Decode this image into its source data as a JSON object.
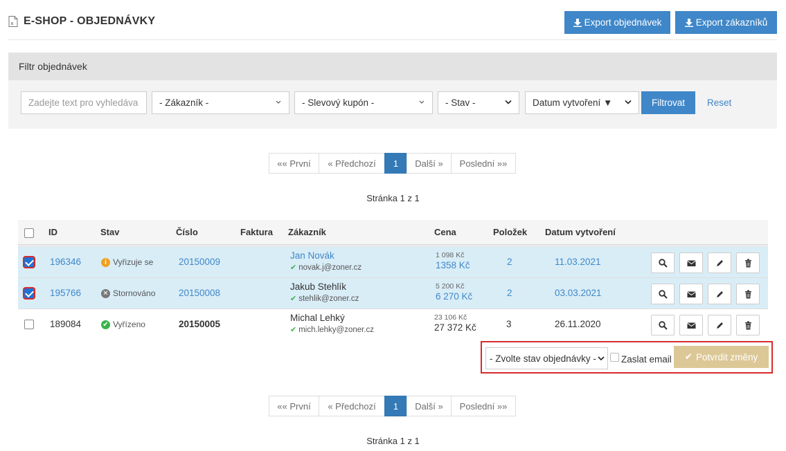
{
  "header": {
    "title": "E-SHOP - OBJEDNÁVKY",
    "export_orders": "Export objednávek",
    "export_customers": "Export zákazníků"
  },
  "filter": {
    "heading": "Filtr objednávek",
    "search_placeholder": "Zadejte text pro vyhledáva",
    "customer": "- Zákazník -",
    "coupon": "- Slevový kupón -",
    "state": "- Stav -",
    "sort": "Datum vytvoření ▼",
    "filter_button": "Filtrovat",
    "reset": "Reset"
  },
  "pagination": {
    "first": "«« První",
    "prev": "« Předchozí",
    "current": "1",
    "next": "Další »",
    "last": "Poslední »»",
    "info": "Stránka 1 z 1"
  },
  "table": {
    "columns": [
      "ID",
      "Stav",
      "Číslo",
      "Faktura",
      "Zákazník",
      "Cena",
      "Položek",
      "Datum vytvoření"
    ],
    "rows": [
      {
        "id": "196346",
        "status": "Vyřizuje se",
        "status_icon": "info-icon",
        "status_color": "#f0a020",
        "number": "20150009",
        "customer": "Jan Novák",
        "email": "novak.j@zoner.cz",
        "price_old": "1 098 Kč",
        "price": "1358 Kč",
        "items": "2",
        "date": "11.03.2021",
        "selected": true
      },
      {
        "id": "195766",
        "status": "Stornováno",
        "status_icon": "cancel-icon",
        "status_color": "#777777",
        "number": "20150008",
        "customer": "Jakub Stehlík",
        "email": "stehlik@zoner.cz",
        "price_old": "5 200 Kč",
        "price": "6 270 Kč",
        "items": "2",
        "date": "03.03.2021",
        "selected": true
      },
      {
        "id": "189084",
        "status": "Vyřízeno",
        "status_icon": "check-circle-icon",
        "status_color": "#3ab34a",
        "number": "20150005",
        "customer": "Michal Lehký",
        "email": "mich.lehky@zoner.cz",
        "price_old": "23 106 Kč",
        "price": "27 372 Kč",
        "items": "3",
        "date": "26.11.2020",
        "selected": false
      }
    ]
  },
  "bulk": {
    "state_select": "- Zvolte stav objednávky -",
    "send_email": "Zaslat email",
    "confirm": "Potvrdit změny"
  }
}
